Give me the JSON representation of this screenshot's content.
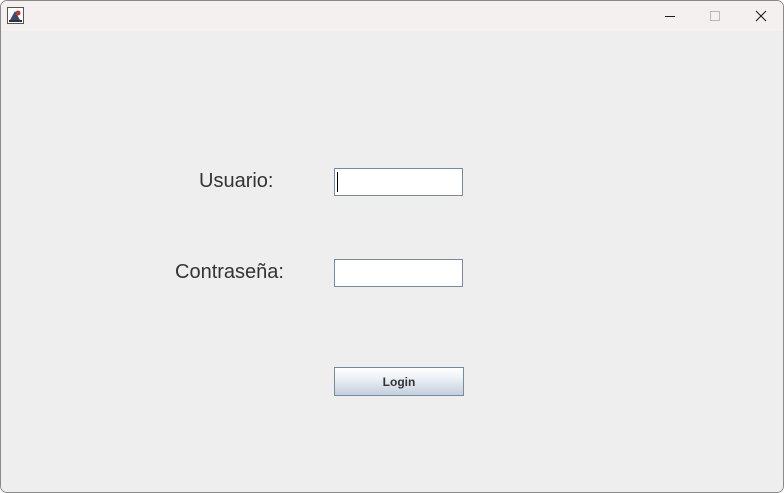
{
  "window": {
    "icon": "java-app-icon",
    "controls": {
      "minimize": "minimize-icon",
      "maximize": "maximize-icon",
      "close": "close-icon"
    }
  },
  "form": {
    "username_label": "Usuario:",
    "username_value": "",
    "password_label": "Contraseña:",
    "password_value": "",
    "login_label": "Login"
  },
  "colors": {
    "background": "#eeeeee",
    "titlebar": "#f5f0f0",
    "field_border": "#7a8a99",
    "text": "#333333"
  }
}
